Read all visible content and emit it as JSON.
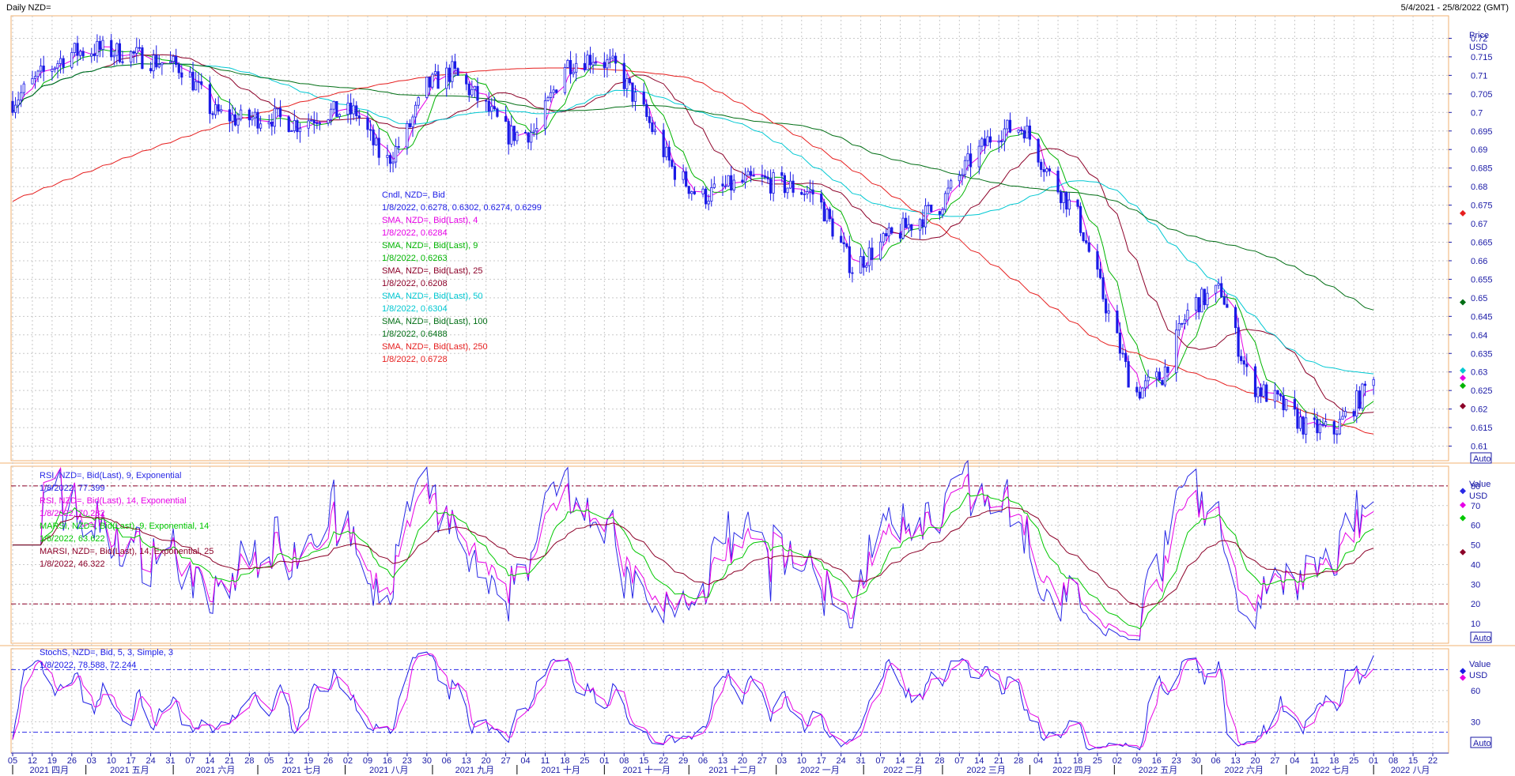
{
  "header": {
    "title": "Daily NZD=",
    "date_range": "5/4/2021 - 25/8/2022 (GMT)"
  },
  "auto_label": "Auto",
  "colors": {
    "candle": "#1a1ae6",
    "sma4": "#e600e6",
    "sma9": "#00b400",
    "sma25": "#8c0028",
    "sma50": "#00c8d2",
    "sma100": "#006e14",
    "sma250": "#e61e1e",
    "rsi9": "#2828e6",
    "rsi14": "#e600e6",
    "marsi9": "#00c800",
    "marsi14": "#8c0028",
    "stoch_k": "#1a1ae6",
    "stoch_d": "#e600e6",
    "grid": "#c8c8c8",
    "frame": "#f0b070"
  },
  "x_axis": {
    "day_ticks": [
      "05",
      "12",
      "19",
      "26",
      "03",
      "10",
      "17",
      "24",
      "31",
      "07",
      "14",
      "21",
      "28",
      "05",
      "12",
      "19",
      "26",
      "02",
      "09",
      "16",
      "23",
      "30",
      "06",
      "13",
      "20",
      "27",
      "04",
      "11",
      "18",
      "25",
      "01",
      "08",
      "15",
      "22",
      "29",
      "06",
      "13",
      "20",
      "27",
      "03",
      "10",
      "17",
      "24",
      "31",
      "07",
      "14",
      "21",
      "28",
      "07",
      "14",
      "21",
      "28",
      "04",
      "11",
      "18",
      "25",
      "02",
      "09",
      "16",
      "23",
      "30",
      "06",
      "13",
      "20",
      "27",
      "04",
      "11",
      "18",
      "25",
      "01",
      "08",
      "15",
      "22"
    ],
    "months": [
      "2021 四月",
      "2021 五月",
      "2021 六月",
      "2021 七月",
      "2021 八月",
      "2021 九月",
      "2021 十月",
      "2021 十一月",
      "2021 十二月",
      "2022 一月",
      "2022 二月",
      "2022 三月",
      "2022 四月",
      "2022 五月",
      "2022 六月",
      "2022 七月",
      "2022 八月"
    ]
  },
  "panels": {
    "price": {
      "axis_title": "Price",
      "axis_unit": "USD",
      "legend": [
        {
          "name": "Cndl, NZD=, Bid",
          "value": "1/8/2022, 0.6278, 0.6302, 0.6274, 0.6299",
          "color_key": "candle"
        },
        {
          "name": "SMA, NZD=, Bid(Last),  4",
          "value": "1/8/2022, 0.6284",
          "color_key": "sma4"
        },
        {
          "name": "SMA, NZD=, Bid(Last),  9",
          "value": "1/8/2022, 0.6263",
          "color_key": "sma9"
        },
        {
          "name": "SMA, NZD=, Bid(Last),  25",
          "value": "1/8/2022, 0.6208",
          "color_key": "sma25"
        },
        {
          "name": "SMA, NZD=, Bid(Last),  50",
          "value": "1/8/2022, 0.6304",
          "color_key": "sma50"
        },
        {
          "name": "SMA, NZD=, Bid(Last),  100",
          "value": "1/8/2022, 0.6488",
          "color_key": "sma100"
        },
        {
          "name": "SMA, NZD=, Bid(Last),  250",
          "value": "1/8/2022, 0.6728",
          "color_key": "sma250"
        }
      ],
      "ticks": [
        "0.72",
        "0.715",
        "0.71",
        "0.705",
        "0.7",
        "0.695",
        "0.69",
        "0.685",
        "0.68",
        "0.675",
        "0.67",
        "0.665",
        "0.66",
        "0.655",
        "0.65",
        "0.645",
        "0.64",
        "0.635",
        "0.63",
        "0.625",
        "0.62",
        "0.615",
        "0.61"
      ]
    },
    "rsi": {
      "axis_title": "Value",
      "axis_unit": "USD",
      "legend": [
        {
          "name": "RSI, NZD=, Bid(Last),  9, Exponential",
          "value": "1/8/2022, 77.399",
          "color_key": "rsi9"
        },
        {
          "name": "RSI, NZD=, Bid(Last),  14, Exponential",
          "value": "1/8/2022, 70.282",
          "color_key": "rsi14"
        },
        {
          "name": "MARSI, NZD=, Bid(Last),  9, Exponential, 14",
          "value": "1/8/2022, 63.622",
          "color_key": "marsi9"
        },
        {
          "name": "MARSI, NZD=, Bid(Last),  14, Exponential, 25",
          "value": "1/8/2022, 46.322",
          "color_key": "marsi14"
        }
      ],
      "ticks": [
        "80",
        "70",
        "60",
        "50",
        "40",
        "30",
        "20",
        "10"
      ]
    },
    "stoch": {
      "axis_title": "Value",
      "axis_unit": "USD",
      "legend": [
        {
          "name": "StochS, NZD=, Bid,  5, 3, Simple, 3",
          "value": "1/8/2022, 78.588, 72.244",
          "color_key": "stoch_k"
        }
      ],
      "ticks": [
        "60",
        "30"
      ]
    }
  },
  "chart_data": [
    {
      "type": "line",
      "subtype": "candlestick",
      "title": "Daily NZD=",
      "ylabel": "Price USD",
      "ylim": [
        0.605,
        0.725
      ],
      "x_range": [
        "2021-04-05",
        "2022-08-22"
      ],
      "last_values": {
        "date": "1/8/2022",
        "open": 0.6278,
        "high": 0.6302,
        "low": 0.6274,
        "close": 0.6299,
        "sma4": 0.6284,
        "sma9": 0.6263,
        "sma25": 0.6208,
        "sma50": 0.6304,
        "sma100": 0.6488,
        "sma250": 0.6728
      },
      "close_series": {
        "dates": [
          "2021-04-05",
          "2021-04-15",
          "2021-04-25",
          "2021-05-05",
          "2021-05-15",
          "2021-05-25",
          "2021-06-05",
          "2021-06-15",
          "2021-06-25",
          "2021-07-05",
          "2021-07-15",
          "2021-07-25",
          "2021-08-05",
          "2021-08-15",
          "2021-08-22",
          "2021-08-30",
          "2021-09-08",
          "2021-09-18",
          "2021-09-28",
          "2021-10-08",
          "2021-10-18",
          "2021-10-28",
          "2021-11-05",
          "2021-11-15",
          "2021-11-25",
          "2021-12-05",
          "2021-12-15",
          "2021-12-25",
          "2022-01-05",
          "2022-01-15",
          "2022-01-28",
          "2022-02-08",
          "2022-02-18",
          "2022-02-28",
          "2022-03-10",
          "2022-03-20",
          "2022-03-30",
          "2022-04-08",
          "2022-04-18",
          "2022-04-28",
          "2022-05-08",
          "2022-05-18",
          "2022-05-28",
          "2022-06-08",
          "2022-06-18",
          "2022-06-28",
          "2022-07-08",
          "2022-07-18",
          "2022-07-28",
          "2022-08-01"
        ],
        "values": [
          0.703,
          0.71,
          0.716,
          0.717,
          0.716,
          0.714,
          0.712,
          0.7,
          0.698,
          0.699,
          0.697,
          0.7,
          0.7,
          0.686,
          0.693,
          0.707,
          0.711,
          0.703,
          0.694,
          0.695,
          0.713,
          0.715,
          0.712,
          0.7,
          0.685,
          0.677,
          0.68,
          0.682,
          0.68,
          0.678,
          0.658,
          0.665,
          0.67,
          0.675,
          0.686,
          0.695,
          0.696,
          0.683,
          0.672,
          0.648,
          0.624,
          0.629,
          0.648,
          0.652,
          0.627,
          0.622,
          0.615,
          0.614,
          0.624,
          0.63
        ]
      },
      "sma_series": {
        "sma100_end": 0.6488,
        "sma250_start": 0.676,
        "sma250_end": 0.6728
      }
    },
    {
      "type": "line",
      "title": "RSI",
      "ylim": [
        0,
        90
      ],
      "reference_lines": [
        80,
        20
      ],
      "series": [
        {
          "name": "RSI, NZD=, Bid(Last),  9, Exponential",
          "last": 77.399
        },
        {
          "name": "RSI, NZD=, Bid(Last),  14, Exponential",
          "last": 70.282
        },
        {
          "name": "MARSI, NZD=, Bid(Last),  9, Exponential, 14",
          "last": 63.622
        },
        {
          "name": "MARSI, NZD=, Bid(Last),  14, Exponential, 25",
          "last": 46.322
        }
      ]
    },
    {
      "type": "line",
      "title": "StochS",
      "ylim": [
        0,
        100
      ],
      "reference_lines": [
        80,
        20
      ],
      "series": [
        {
          "name": "StochS, NZD=, Bid,  5, 3, Simple, 3",
          "last_k": 78.588,
          "last_d": 72.244
        }
      ]
    }
  ]
}
